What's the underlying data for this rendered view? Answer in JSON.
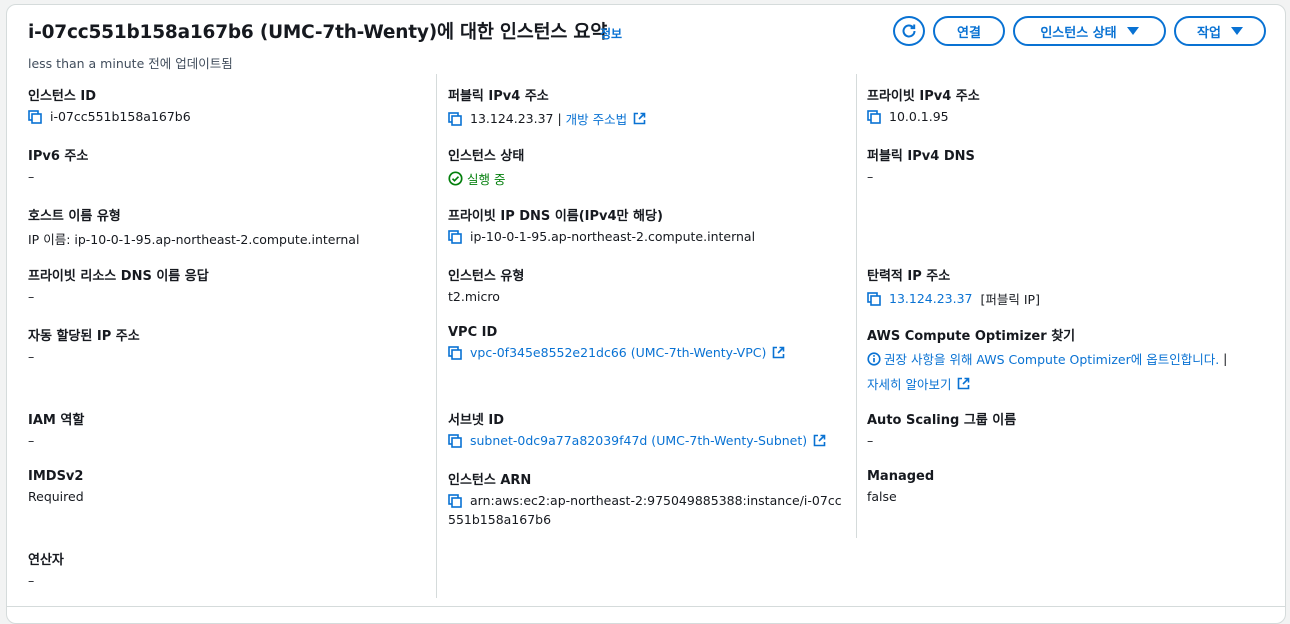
{
  "header": {
    "title": "i-07cc551b158a167b6 (UMC-7th-Wenty)에 대한 인스턴스 요약",
    "info_link": "정보",
    "updated": "less than a minute 전에 업데이트됨"
  },
  "buttons": {
    "connect": "연결",
    "instance_state": "인스턴스 상태",
    "actions": "작업"
  },
  "col1": {
    "instance_id": {
      "label": "인스턴스 ID",
      "value": "i-07cc551b158a167b6"
    },
    "ipv6": {
      "label": "IPv6 주소",
      "value": "–"
    },
    "hostname_type": {
      "label": "호스트 이름 유형",
      "value": "IP 이름: ip-10-0-1-95.ap-northeast-2.compute.internal"
    },
    "private_dns_answer": {
      "label": "프라이빗 리소스 DNS 이름 응답",
      "value": "–"
    },
    "auto_ip": {
      "label": "자동 할당된 IP 주소",
      "value": "–"
    },
    "iam_role": {
      "label": "IAM 역할",
      "value": "–"
    },
    "imdsv2": {
      "label": "IMDSv2",
      "value": "Required"
    },
    "operator": {
      "label": "연산자",
      "value": "–"
    }
  },
  "col2": {
    "public_ipv4": {
      "label": "퍼블릭 IPv4 주소",
      "value": "13.124.23.37",
      "sep": " | ",
      "link": "개방 주소법"
    },
    "instance_state": {
      "label": "인스턴스 상태",
      "value": "실행 중"
    },
    "private_dns": {
      "label": "프라이빗 IP DNS 이름(IPv4만 해당)",
      "value": "ip-10-0-1-95.ap-northeast-2.compute.internal"
    },
    "instance_type": {
      "label": "인스턴스 유형",
      "value": "t2.micro"
    },
    "vpc_id": {
      "label": "VPC ID",
      "value": "vpc-0f345e8552e21dc66 (UMC-7th-Wenty-VPC)"
    },
    "subnet_id": {
      "label": "서브넷 ID",
      "value": "subnet-0dc9a77a82039f47d (UMC-7th-Wenty-Subnet)"
    },
    "arn": {
      "label": "인스턴스 ARN",
      "value_line1": "arn:aws:ec2:ap-northeast-2:975049885388:instance/i-07cc",
      "value_line2": "551b158a167b6"
    }
  },
  "col3": {
    "private_ipv4": {
      "label": "프라이빗 IPv4 주소",
      "value": "10.0.1.95"
    },
    "public_dns": {
      "label": "퍼블릭 IPv4 DNS",
      "value": "–"
    },
    "elastic_ip": {
      "label": "탄력적 IP 주소",
      "value": "13.124.23.37",
      "suffix": "[퍼블릭 IP]"
    },
    "optimizer": {
      "label": "AWS Compute Optimizer 찾기",
      "text": "권장 사항을 위해 AWS Compute Optimizer에 옵트인합니다.",
      "sep": " |",
      "link": "자세히 알아보기"
    },
    "asg": {
      "label": "Auto Scaling 그룹 이름",
      "value": "–"
    },
    "managed": {
      "label": "Managed",
      "value": "false"
    }
  },
  "colors": {
    "link": "#0972d3",
    "running": "#037f0c",
    "divider": "#d5dbdb"
  }
}
